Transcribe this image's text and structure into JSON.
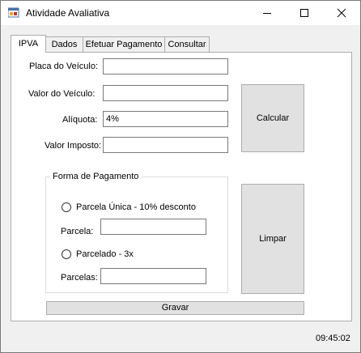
{
  "window": {
    "title": "Atividade Avaliativa"
  },
  "tabs": [
    {
      "label": "IPVA",
      "active": true
    },
    {
      "label": "Dados",
      "active": false
    },
    {
      "label": "Efetuar Pagamento",
      "active": false
    },
    {
      "label": "Consultar",
      "active": false
    }
  ],
  "form": {
    "placa_label": "Placa do Veículo:",
    "placa_value": "",
    "valor_label": "Valor do Veículo:",
    "valor_value": "",
    "aliquota_label": "Alíquota:",
    "aliquota_value": "4%",
    "imposto_label": "Valor Imposto:",
    "imposto_value": ""
  },
  "payment_group": {
    "title": "Forma de Pagamento",
    "option_unica": "Parcela Única - 10% desconto",
    "parcela_label": "Parcela:",
    "parcela_value": "",
    "option_parcelado": "Parcelado - 3x",
    "parcelas_label": "Parcelas:",
    "parcelas_value": ""
  },
  "buttons": {
    "calcular": "Calcular",
    "limpar": "Limpar",
    "gravar": "Gravar"
  },
  "status": {
    "time": "09:45:02"
  },
  "icons": {
    "app": "app-window-icon",
    "minimize": "minimize-icon",
    "maximize": "maximize-icon",
    "close": "close-icon"
  }
}
